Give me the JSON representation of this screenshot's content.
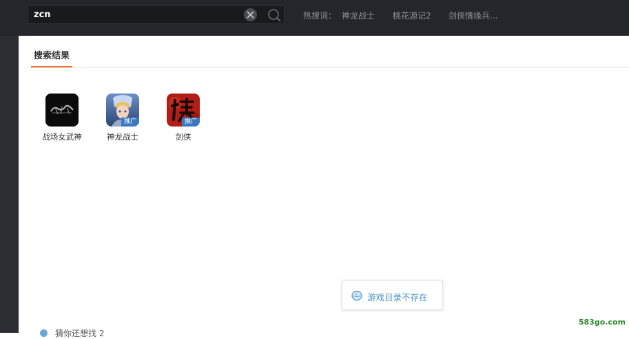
{
  "search": {
    "value": "zcn",
    "hot_label": "热搜词：",
    "hot_words": [
      "神龙战士",
      "桃花源记2",
      "剑侠情缘兵..."
    ]
  },
  "tabs": {
    "active": "搜索结果"
  },
  "results": [
    {
      "name": "战场女武神",
      "icon": "game-icon-dark",
      "badge": ""
    },
    {
      "name": "神龙战士",
      "icon": "game-icon-warrior",
      "badge": "推广"
    },
    {
      "name": "剑侠",
      "icon": "game-icon-red-glyph",
      "badge": "推广"
    }
  ],
  "toast": {
    "text": "游戏目录不存在",
    "icon": "fish-bowl-icon"
  },
  "bottom": {
    "text": "猜你还想找 2"
  },
  "watermark": "583go.com",
  "colors": {
    "topbar": "#24262b",
    "tab_accent": "#e8722a",
    "badge": "#3a79c2",
    "toast_text": "#4a90c8"
  }
}
